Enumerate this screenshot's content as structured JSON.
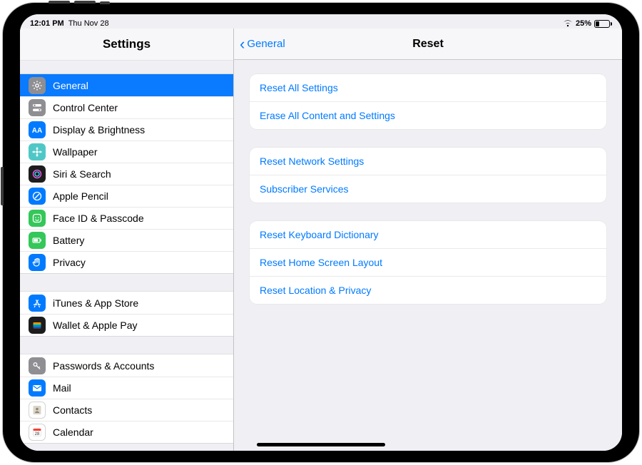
{
  "status": {
    "time": "12:01 PM",
    "date": "Thu Nov 28",
    "battery_pct": "25%",
    "battery_fill_pct": 25
  },
  "sidebar": {
    "title": "Settings",
    "groups": [
      {
        "items": [
          {
            "name": "general",
            "label": "General",
            "icon": "gear",
            "bg": "bg-gray",
            "selected": true
          },
          {
            "name": "control-center",
            "label": "Control Center",
            "icon": "switches",
            "bg": "bg-gray"
          },
          {
            "name": "display",
            "label": "Display & Brightness",
            "icon": "aa",
            "bg": "bg-blue"
          },
          {
            "name": "wallpaper",
            "label": "Wallpaper",
            "icon": "flower",
            "bg": "bg-teal"
          },
          {
            "name": "siri",
            "label": "Siri & Search",
            "icon": "siri",
            "bg": "bg-dark"
          },
          {
            "name": "pencil",
            "label": "Apple Pencil",
            "icon": "pencil",
            "bg": "bg-blue"
          },
          {
            "name": "faceid",
            "label": "Face ID & Passcode",
            "icon": "face",
            "bg": "bg-green"
          },
          {
            "name": "battery",
            "label": "Battery",
            "icon": "battery",
            "bg": "bg-green"
          },
          {
            "name": "privacy",
            "label": "Privacy",
            "icon": "hand",
            "bg": "bg-blue"
          }
        ]
      },
      {
        "items": [
          {
            "name": "itunes",
            "label": "iTunes & App Store",
            "icon": "appstore",
            "bg": "bg-blue"
          },
          {
            "name": "wallet",
            "label": "Wallet & Apple Pay",
            "icon": "wallet",
            "bg": "bg-dark"
          }
        ]
      },
      {
        "items": [
          {
            "name": "passwords",
            "label": "Passwords & Accounts",
            "icon": "key",
            "bg": "bg-gray"
          },
          {
            "name": "mail",
            "label": "Mail",
            "icon": "mail",
            "bg": "bg-blue"
          },
          {
            "name": "contacts",
            "label": "Contacts",
            "icon": "contacts",
            "bg": "bg-white"
          },
          {
            "name": "calendar",
            "label": "Calendar",
            "icon": "calendar",
            "bg": "bg-white"
          }
        ]
      }
    ]
  },
  "main": {
    "back_label": "General",
    "title": "Reset",
    "groups": [
      {
        "items": [
          {
            "name": "reset-all",
            "label": "Reset All Settings"
          },
          {
            "name": "erase-all",
            "label": "Erase All Content and Settings"
          }
        ]
      },
      {
        "items": [
          {
            "name": "reset-network",
            "label": "Reset Network Settings"
          },
          {
            "name": "subscriber",
            "label": "Subscriber Services"
          }
        ]
      },
      {
        "items": [
          {
            "name": "reset-keyboard",
            "label": "Reset Keyboard Dictionary"
          },
          {
            "name": "reset-home",
            "label": "Reset Home Screen Layout"
          },
          {
            "name": "reset-location",
            "label": "Reset Location & Privacy"
          }
        ]
      }
    ]
  }
}
